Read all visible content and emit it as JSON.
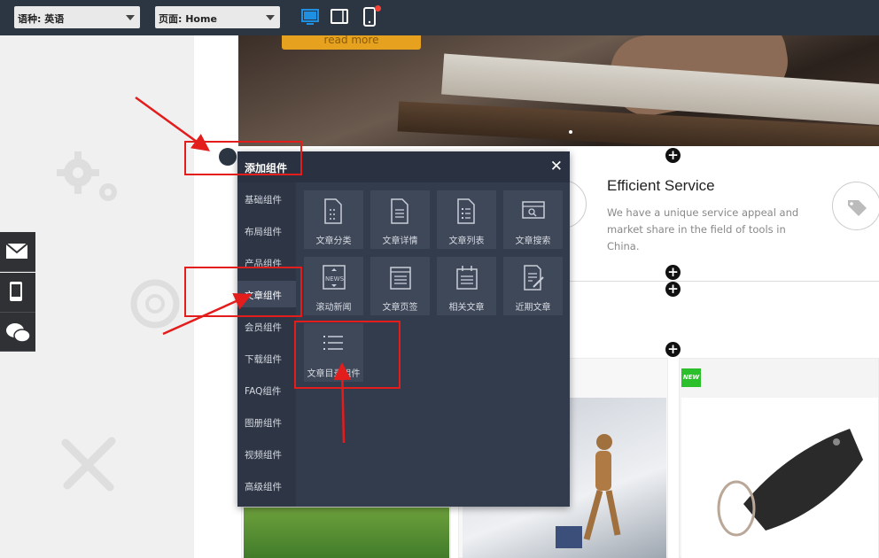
{
  "toolbar": {
    "language_label": "语种: 英语",
    "page_label": "页面: Home",
    "devices": [
      "desktop-icon",
      "tablet-icon",
      "mobile-icon"
    ],
    "active_device": "desktop"
  },
  "hero": {
    "button_label": "read more"
  },
  "service": {
    "title": "Efficient Service",
    "text": "We have a unique service appeal and market share in the field of tools in China."
  },
  "product": {
    "badge": "NEW"
  },
  "panel": {
    "title": "添加组件",
    "close": "✕",
    "categories": [
      {
        "label": "基础组件"
      },
      {
        "label": "布局组件"
      },
      {
        "label": "产品组件"
      },
      {
        "label": "文章组件"
      },
      {
        "label": "会员组件"
      },
      {
        "label": "下载组件"
      },
      {
        "label": "FAQ组件"
      },
      {
        "label": "图册组件"
      },
      {
        "label": "视频组件"
      },
      {
        "label": "高级组件"
      }
    ],
    "active_category": "文章组件",
    "components": [
      {
        "label": "文章分类",
        "icon": "doc-dots-icon"
      },
      {
        "label": "文章详情",
        "icon": "doc-lines-icon"
      },
      {
        "label": "文章列表",
        "icon": "doc-list-icon"
      },
      {
        "label": "文章搜索",
        "icon": "search-box-icon"
      },
      {
        "label": "滚动新闻",
        "icon": "news-icon"
      },
      {
        "label": "文章页签",
        "icon": "tab-doc-icon"
      },
      {
        "label": "相关文章",
        "icon": "related-doc-icon"
      },
      {
        "label": "近期文章",
        "icon": "recent-doc-icon"
      },
      {
        "label": "文章目录组件",
        "icon": "list-menu-icon"
      }
    ]
  },
  "colors": {
    "toolbar_bg": "#2c3542",
    "panel_bg": "#333c4d",
    "accent_blue": "#1e8fe1",
    "annotation_red": "#e31c1c"
  }
}
